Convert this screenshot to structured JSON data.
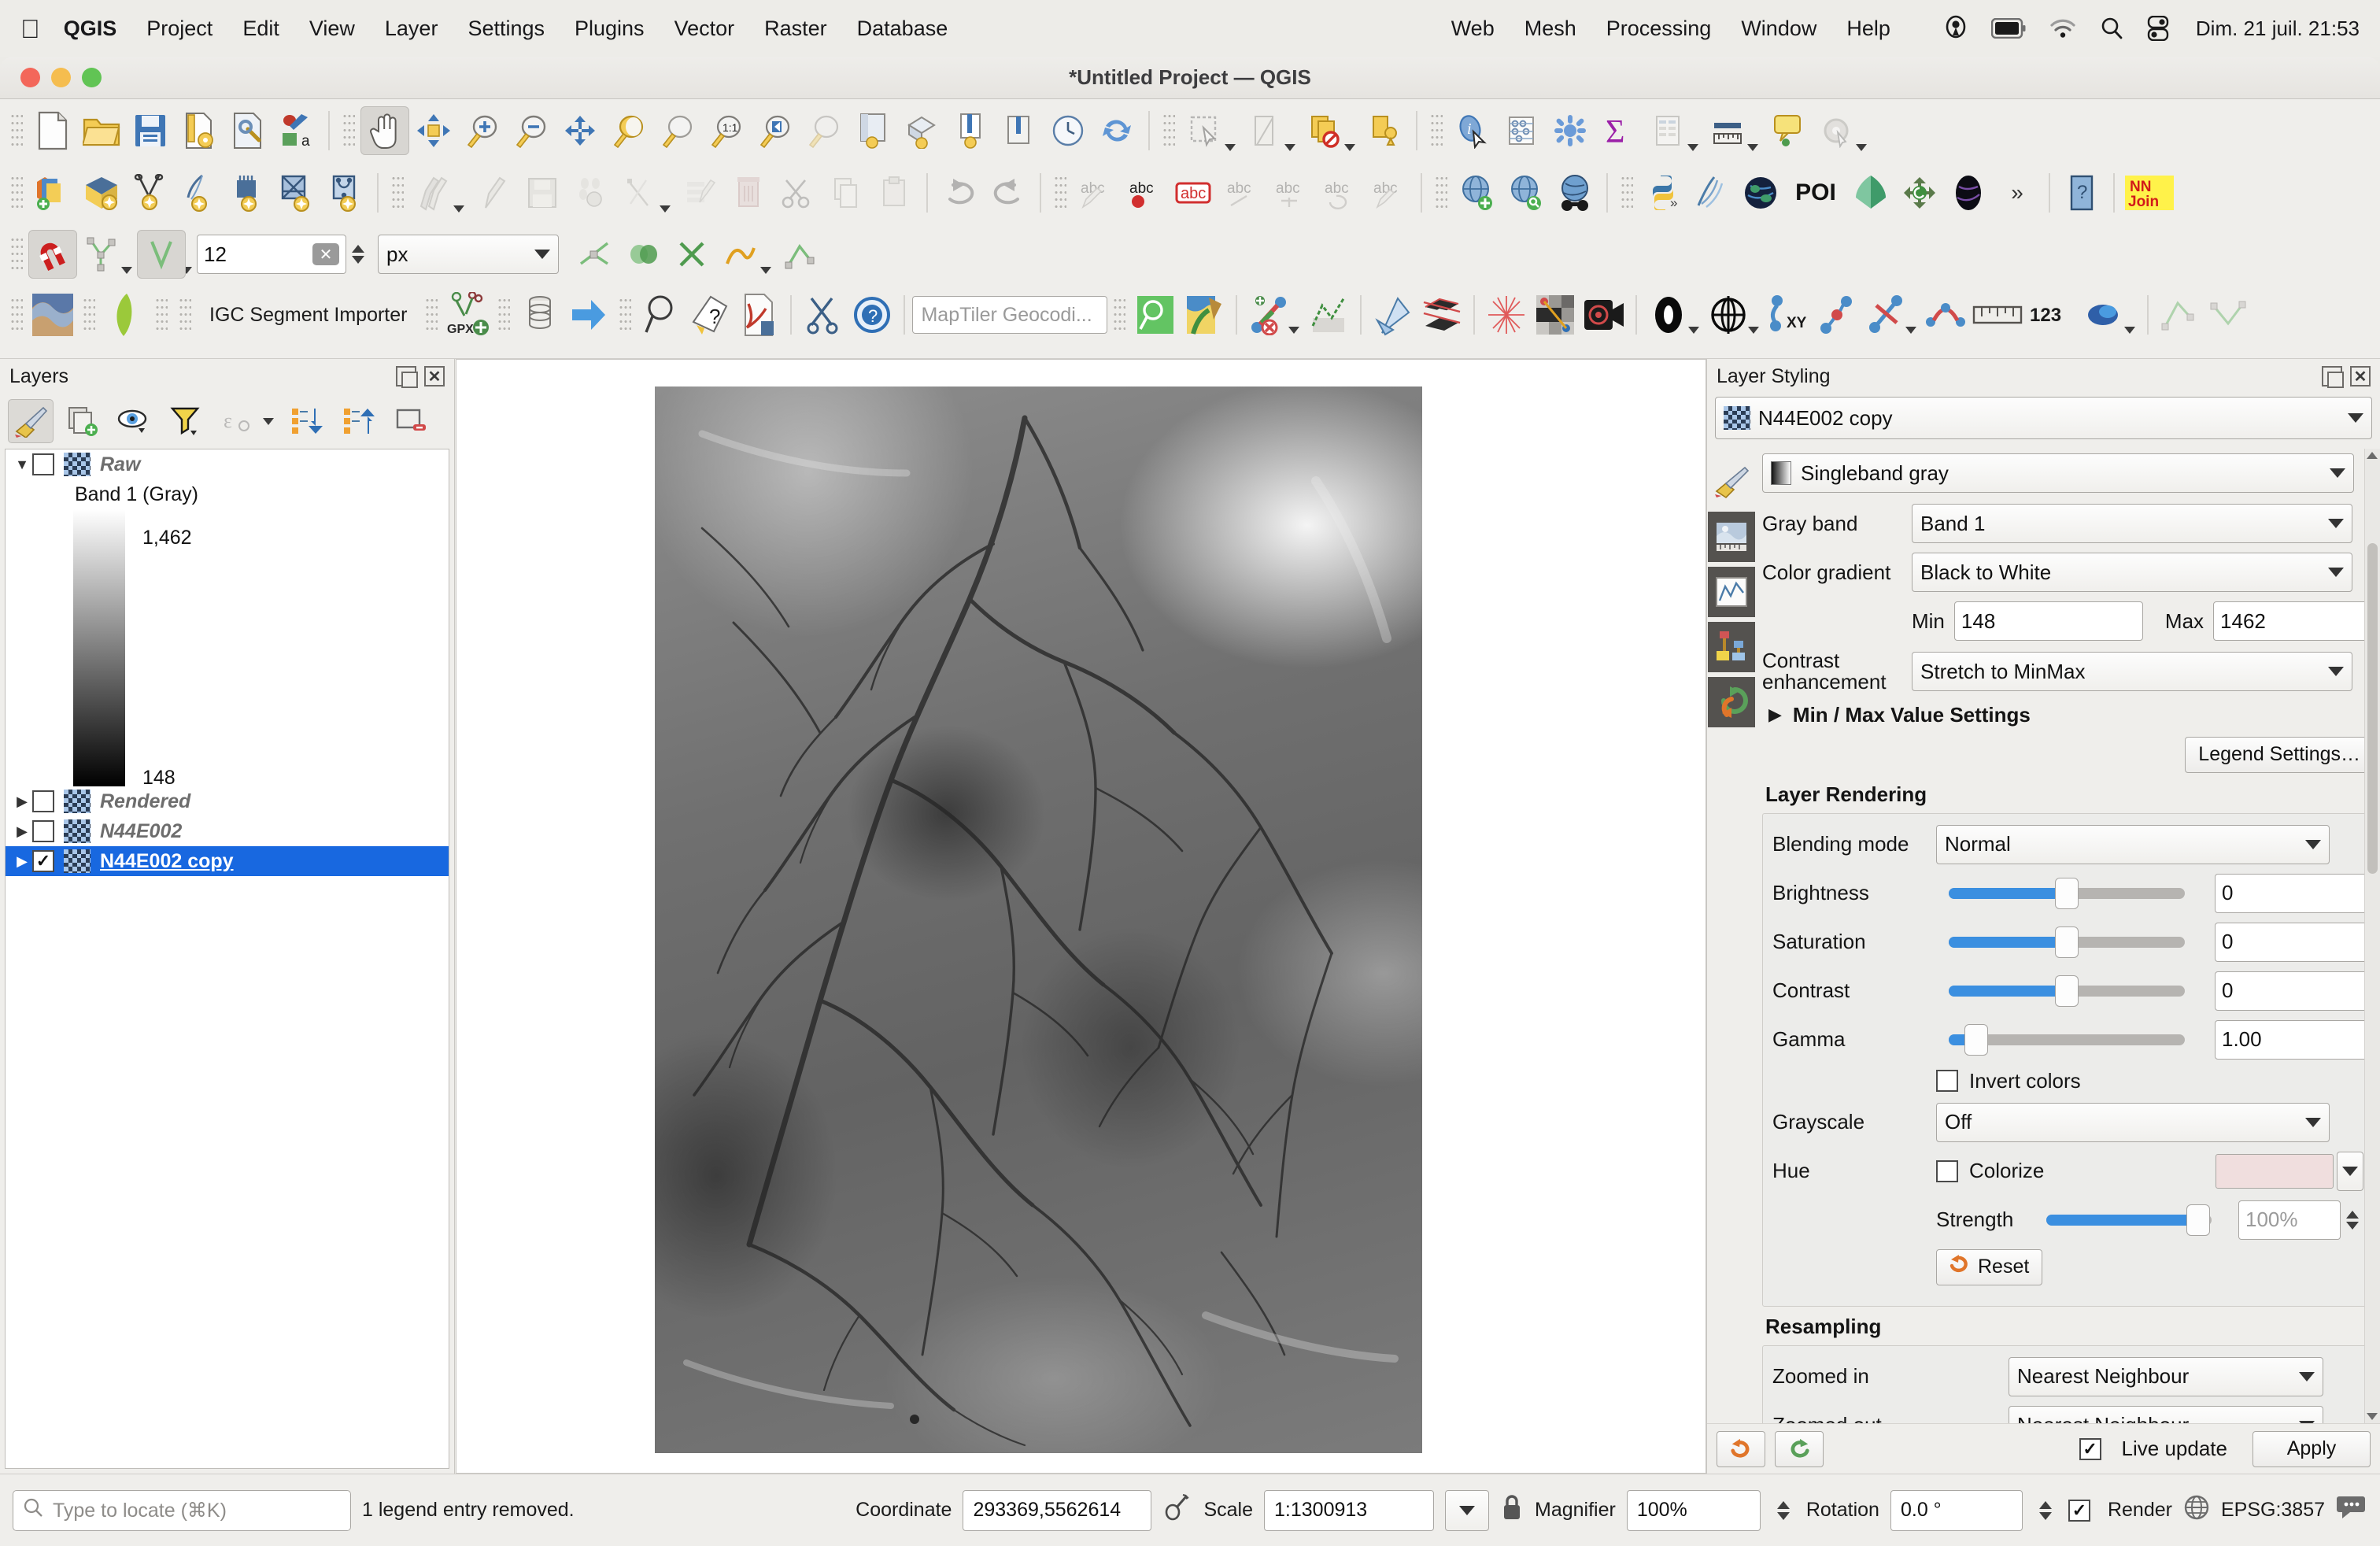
{
  "macbar": {
    "apple_icon": "apple-icon",
    "menus": [
      {
        "label": "QGIS",
        "bold": true
      },
      {
        "label": "Project",
        "bold": false
      },
      {
        "label": "Edit",
        "bold": false
      },
      {
        "label": "View",
        "bold": false
      },
      {
        "label": "Layer",
        "bold": false
      },
      {
        "label": "Settings",
        "bold": false
      },
      {
        "label": "Plugins",
        "bold": false
      },
      {
        "label": "Vector",
        "bold": false
      },
      {
        "label": "Raster",
        "bold": false
      },
      {
        "label": "Database",
        "bold": false
      },
      {
        "label": "Web",
        "bold": false
      },
      {
        "label": "Mesh",
        "bold": false
      },
      {
        "label": "Processing",
        "bold": false
      },
      {
        "label": "Window",
        "bold": false
      },
      {
        "label": "Help",
        "bold": false
      }
    ],
    "sys_icons": [
      "location-icon",
      "battery-icon",
      "wifi-icon",
      "search-icon",
      "control-center-icon"
    ],
    "clock": "Dim. 21 juil.  21:53"
  },
  "window": {
    "title": "*Untitled Project — QGIS",
    "traffic_lights": [
      "close-button",
      "minimize-button",
      "maximize-button"
    ]
  },
  "toolbars": {
    "row1": [
      {
        "name": "new-project-button",
        "glyph": "page"
      },
      {
        "name": "open-project-button",
        "glyph": "folder"
      },
      {
        "name": "save-project-button",
        "glyph": "save"
      },
      {
        "name": "save-project-as-button",
        "glyph": "saveas"
      },
      {
        "name": "project-properties-button",
        "glyph": "props"
      },
      {
        "name": "style-manager-button",
        "glyph": "style"
      },
      {
        "name": "pan-map-button",
        "glyph": "hand",
        "active": true
      },
      {
        "name": "pan-to-selection-button",
        "glyph": "pansel"
      },
      {
        "name": "zoom-in-button",
        "glyph": "zoomin"
      },
      {
        "name": "zoom-out-button",
        "glyph": "zoomout"
      },
      {
        "name": "zoom-full-button",
        "glyph": "zoomfull"
      },
      {
        "name": "zoom-to-selection-button",
        "glyph": "zoomsel"
      },
      {
        "name": "zoom-to-layer-button",
        "glyph": "zoomlayer"
      },
      {
        "name": "zoom-native-button",
        "glyph": "zoom11"
      },
      {
        "name": "zoom-last-button",
        "glyph": "zoomlast"
      },
      {
        "name": "zoom-next-button",
        "glyph": "zoomnext"
      },
      {
        "name": "new-map-view-button",
        "glyph": "mapview"
      },
      {
        "name": "new-3d-map-view-button",
        "glyph": "map3d"
      },
      {
        "name": "new-print-layout-button",
        "glyph": "layout"
      },
      {
        "name": "layout-manager-button",
        "glyph": "layoutmgr"
      },
      {
        "name": "temporal-controller-button",
        "glyph": "clock"
      },
      {
        "name": "refresh-button",
        "glyph": "refresh"
      },
      {
        "name": "select-features-button",
        "glyph": "select"
      },
      {
        "name": "select-by-value-button",
        "glyph": "selvalue"
      },
      {
        "name": "deselect-features-button",
        "glyph": "deselect"
      },
      {
        "name": "select-by-location-button",
        "glyph": "selloc"
      },
      {
        "name": "identify-features-button",
        "glyph": "identify",
        "cursor": true
      },
      {
        "name": "open-attribute-table-button",
        "glyph": "attrtable"
      },
      {
        "name": "field-calculator-button",
        "glyph": "calc"
      },
      {
        "name": "statistical-summary-button",
        "glyph": "sigma"
      },
      {
        "name": "show-statistics-button",
        "glyph": "stats"
      },
      {
        "name": "measure-line-button",
        "glyph": "measure"
      },
      {
        "name": "map-tips-button",
        "glyph": "maptip"
      },
      {
        "name": "run-feature-action-button",
        "glyph": "action"
      }
    ],
    "row2": [
      {
        "name": "open-data-source-manager-button",
        "glyph": "datasrc"
      },
      {
        "name": "add-vector-layer-button",
        "glyph": "vector"
      },
      {
        "name": "add-raster-layer-button",
        "glyph": "raster"
      },
      {
        "name": "add-mesh-layer-button",
        "glyph": "mesh"
      },
      {
        "name": "add-delimited-text-layer-button",
        "glyph": "text"
      },
      {
        "name": "add-postgis-layer-button",
        "glyph": "postgis"
      },
      {
        "name": "add-spatialite-layer-button",
        "glyph": "spatialite"
      },
      {
        "name": "current-edits-button",
        "glyph": "edits"
      },
      {
        "name": "toggle-editing-button",
        "glyph": "pencil"
      },
      {
        "name": "save-layer-edits-button",
        "glyph": "savelayer"
      },
      {
        "name": "add-feature-button",
        "glyph": "addfeat"
      },
      {
        "name": "vertex-tool-button",
        "glyph": "vertex"
      },
      {
        "name": "modify-attributes-button",
        "glyph": "modattr"
      },
      {
        "name": "delete-selected-button",
        "glyph": "delete"
      },
      {
        "name": "cut-features-button",
        "glyph": "cut"
      },
      {
        "name": "copy-features-button",
        "glyph": "copy"
      },
      {
        "name": "paste-features-button",
        "glyph": "paste"
      },
      {
        "name": "undo-button",
        "glyph": "undo"
      },
      {
        "name": "redo-button",
        "glyph": "redo"
      },
      {
        "name": "label-toggle-button",
        "glyph": "abc"
      },
      {
        "name": "highlight-pinned-labels-button",
        "glyph": "abcpin"
      },
      {
        "name": "pin-labels-button",
        "glyph": "abcred"
      },
      {
        "name": "show-hide-labels-button",
        "glyph": "abc2"
      },
      {
        "name": "move-label-button",
        "glyph": "abc3"
      },
      {
        "name": "rotate-label-button",
        "glyph": "abc4"
      },
      {
        "name": "change-label-button",
        "glyph": "abc5"
      },
      {
        "name": "add-wms-layer-button",
        "glyph": "globe-plus"
      },
      {
        "name": "add-wfs-layer-button",
        "glyph": "globe-search"
      },
      {
        "name": "metasearch-button",
        "glyph": "binoculars"
      },
      {
        "name": "python-console-button",
        "glyph": "python"
      },
      {
        "name": "qgis2web-button",
        "glyph": "web"
      },
      {
        "name": "openlayers-plugin-button",
        "glyph": "earth"
      },
      {
        "name": "poi-plugin-button",
        "glyph": "POI"
      },
      {
        "name": "qfield-sync-button",
        "glyph": "leaf"
      },
      {
        "name": "refresh-plugin-button",
        "glyph": "qarrow"
      },
      {
        "name": "nightmapping-plugin-button",
        "glyph": "night"
      },
      {
        "name": "toolbar-overflow-button",
        "glyph": "chevrons"
      },
      {
        "name": "help-plugin-button",
        "glyph": "bluedoor"
      },
      {
        "name": "nnjoin-plugin-button",
        "glyph": "NNJoin"
      }
    ],
    "row3": {
      "snapping_toggle": {
        "name": "enable-snapping-button",
        "active": true
      },
      "snapping_mode": {
        "name": "snapping-mode-button"
      },
      "snapping_type": {
        "name": "snapping-type-button",
        "active": true
      },
      "tolerance_value": "12",
      "tolerance_units": "px",
      "buttons": [
        {
          "name": "topological-editing-button"
        },
        {
          "name": "avoid-overlap-button"
        },
        {
          "name": "snapping-self-button"
        },
        {
          "name": "enable-tracing-button"
        },
        {
          "name": "snapping-options-button"
        }
      ]
    },
    "row4": {
      "plugin_label": "IGC Segment Importer",
      "geocoder_placeholder": "MapTiler Geocodi...",
      "buttons": [
        {
          "name": "terrain-profile-plugin-button"
        },
        {
          "name": "qgis-leaf-plugin-button"
        },
        {
          "name": "gpx-segment-plugin-button"
        },
        {
          "name": "database-plugin-button"
        },
        {
          "name": "arrow-plugin-button"
        },
        {
          "name": "search-plugin-button"
        },
        {
          "name": "question-plugin-button"
        },
        {
          "name": "pdf-plugin-button"
        },
        {
          "name": "tools-plugin-button"
        },
        {
          "name": "info-plugin-button"
        },
        {
          "name": "maptiler-search-button"
        },
        {
          "name": "map-style-button"
        },
        {
          "name": "profile-tool-button"
        },
        {
          "name": "profile-chart-button"
        },
        {
          "name": "terrain-shading-button"
        },
        {
          "name": "raster-stack-button"
        },
        {
          "name": "burst-plugin-button"
        },
        {
          "name": "grid-plugin-button"
        },
        {
          "name": "camera-plugin-button"
        },
        {
          "name": "circle-tool-button"
        },
        {
          "name": "globe-grid-button"
        },
        {
          "name": "xy-tool-button"
        },
        {
          "name": "node-tool-button"
        },
        {
          "name": "cross-tool-button"
        },
        {
          "name": "link-tool-button"
        },
        {
          "name": "ruler-tool-button"
        },
        {
          "name": "numbers-tool-button"
        },
        {
          "name": "color-tool-button"
        },
        {
          "name": "extra-tool-1-button"
        },
        {
          "name": "extra-tool-2-button"
        }
      ]
    }
  },
  "layers_panel": {
    "title": "Layers",
    "toolbar_buttons": [
      {
        "name": "open-layer-styling-panel-button",
        "active": true
      },
      {
        "name": "add-group-button"
      },
      {
        "name": "manage-map-themes-button"
      },
      {
        "name": "filter-legend-button"
      },
      {
        "name": "filter-legend-expression-button"
      },
      {
        "name": "expand-all-button"
      },
      {
        "name": "collapse-all-button"
      },
      {
        "name": "remove-layer-button"
      }
    ],
    "tree": [
      {
        "name": "Raw",
        "checked": false,
        "expanded": true,
        "selected": false,
        "legend": {
          "band_label": "Band 1 (Gray)",
          "max": "1,462",
          "min": "148"
        }
      },
      {
        "name": "Rendered",
        "checked": false,
        "expanded": false,
        "selected": false
      },
      {
        "name": "N44E002",
        "checked": false,
        "expanded": false,
        "selected": false
      },
      {
        "name": "N44E002 copy",
        "checked": true,
        "expanded": false,
        "selected": true
      }
    ]
  },
  "styling_panel": {
    "title": "Layer Styling",
    "layer_selector": "N44E002 copy",
    "renderer": "Singleband gray",
    "rail_icons": [
      "symbology-icon",
      "transparency-icon",
      "histogram-icon",
      "rendering-icon",
      "history-icon"
    ],
    "fields": {
      "gray_band_label": "Gray band",
      "gray_band_value": "Band 1",
      "color_gradient_label": "Color gradient",
      "color_gradient_value": "Black to White",
      "min_label": "Min",
      "min_value": "148",
      "max_label": "Max",
      "max_value": "1462",
      "contrast_label": "Contrast enhancement",
      "contrast_value": "Stretch to MinMax",
      "minmax_settings": "Min / Max Value Settings",
      "legend_settings_button": "Legend Settings…"
    },
    "layer_rendering": {
      "title": "Layer Rendering",
      "blending_label": "Blending mode",
      "blending_value": "Normal",
      "brightness_label": "Brightness",
      "brightness_value": "0",
      "brightness_pct": 50,
      "saturation_label": "Saturation",
      "saturation_value": "0",
      "saturation_pct": 50,
      "contrast_label": "Contrast",
      "contrast_value": "0",
      "contrast_pct": 50,
      "gamma_label": "Gamma",
      "gamma_value": "1.00",
      "gamma_pct": 10,
      "invert_colors_label": "Invert colors",
      "invert_colors_checked": false,
      "grayscale_label": "Grayscale",
      "grayscale_value": "Off",
      "hue_label": "Hue",
      "colorize_label": "Colorize",
      "colorize_checked": false,
      "colorize_color": "#f0dede",
      "strength_label": "Strength",
      "strength_value": "100%",
      "strength_pct": 92,
      "reset_button": "Reset"
    },
    "resampling": {
      "title": "Resampling",
      "zoomed_in_label": "Zoomed in",
      "zoomed_in_value": "Nearest Neighbour",
      "zoomed_out_label": "Zoomed out",
      "zoomed_out_value": "Nearest Neighbour"
    },
    "footer": {
      "undo_button": "undo-icon",
      "redo_button": "redo-icon",
      "live_update_label": "Live update",
      "live_update_checked": true,
      "apply_button": "Apply"
    }
  },
  "status_bar": {
    "locate_placeholder": "Type to locate (⌘K)",
    "message": "1 legend entry removed.",
    "coordinate_label": "Coordinate",
    "coordinate_value": "293369,5562614",
    "scale_label": "Scale",
    "scale_value": "1:1300913",
    "magnifier_label": "Magnifier",
    "magnifier_value": "100%",
    "rotation_label": "Rotation",
    "rotation_value": "0.0 °",
    "render_label": "Render",
    "render_checked": true,
    "crs_label": "EPSG:3857",
    "messages_icon": "messages-icon",
    "lock_icon": "lock-icon",
    "pin-icon": "pin-icon"
  },
  "colors": {
    "accent_blue": "#1868e0",
    "slider_blue": "#3b8fe0",
    "chrome": "#efeeeb",
    "menubar": "#edece8"
  }
}
